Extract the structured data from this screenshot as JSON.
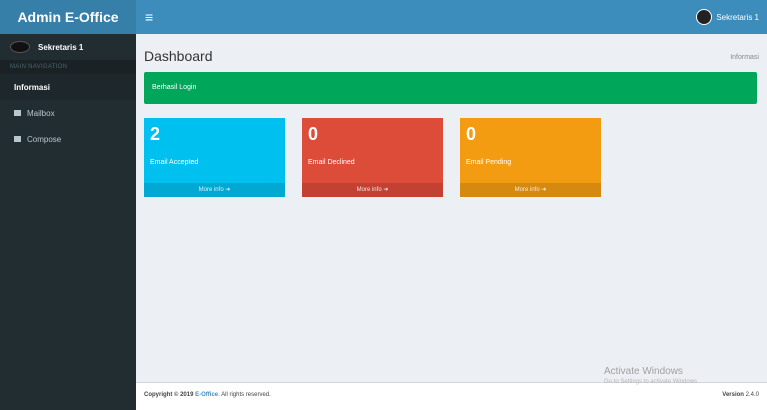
{
  "header": {
    "logo": "Admin E-Office",
    "toggle_icon": "hamburger-icon",
    "user_name": "Sekretaris 1"
  },
  "sidebar": {
    "user_name": "Sekretaris 1",
    "section": "MAIN NAVIGATION",
    "items": [
      {
        "label": "Informasi",
        "icon": "",
        "active": true
      },
      {
        "label": "Mailbox",
        "icon": "mailbox-icon",
        "active": false
      },
      {
        "label": "Compose",
        "icon": "compose-icon",
        "active": false
      }
    ]
  },
  "main": {
    "title": "Dashboard",
    "breadcrumb": "Informasi",
    "alert": "Berhasil Login",
    "boxes": [
      {
        "value": "2",
        "label": "Email Accepted",
        "more": "More info",
        "color": "#00c0ef"
      },
      {
        "value": "0",
        "label": "Email Declined",
        "more": "More info",
        "color": "#dd4b39"
      },
      {
        "value": "0",
        "label": "Email Pending",
        "more": "More info",
        "color": "#f39c12"
      }
    ]
  },
  "footer": {
    "copyright": "Copyright © 2019",
    "link": "E-Office",
    "rights": ". All rights reserved.",
    "version_label": "Version",
    "version": "2.4.0"
  },
  "watermark": {
    "line1": "Activate Windows",
    "line2": "Go to Settings to activate Windows."
  }
}
